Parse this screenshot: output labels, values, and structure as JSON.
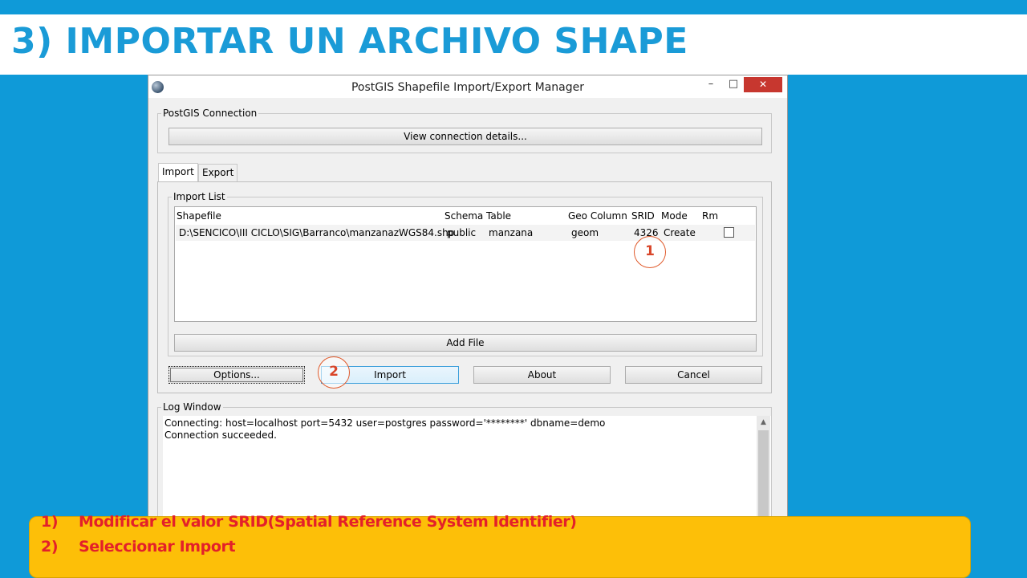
{
  "slide": {
    "title": "3) IMPORTAR UN ARCHIVO SHAPE"
  },
  "window": {
    "title": "PostGIS Shapefile Import/Export Manager",
    "minimize_glyph": "–",
    "maximize_glyph": "□",
    "close_glyph": "✕"
  },
  "connection": {
    "group_label": "PostGIS Connection",
    "view_details_label": "View connection details..."
  },
  "tabs": [
    {
      "label": "Import",
      "active": true
    },
    {
      "label": "Export",
      "active": false
    }
  ],
  "import_list": {
    "group_label": "Import List",
    "columns": [
      "Shapefile",
      "Schema",
      "Table",
      "Geo Column",
      "SRID",
      "Mode",
      "Rm"
    ],
    "rows": [
      {
        "shapefile": "D:\\SENCICO\\III CICLO\\SIG\\Barranco\\manzanazWGS84.shp",
        "schema": "public",
        "table": "manzana",
        "geo_column": "geom",
        "srid": "4326",
        "mode": "Create",
        "rm": false
      }
    ],
    "add_file_label": "Add File"
  },
  "actions": {
    "options_label": "Options...",
    "import_label": "Import",
    "about_label": "About",
    "cancel_label": "Cancel"
  },
  "log": {
    "group_label": "Log Window",
    "lines": [
      "Connecting:  host=localhost port=5432 user=postgres password='********' dbname=demo",
      "Connection succeeded."
    ]
  },
  "markers": [
    "1",
    "2"
  ],
  "notes": [
    {
      "number": "1)",
      "text": "Modificar el valor SRID(Spatial Reference System Identifier)"
    },
    {
      "number": "2)",
      "text": "Seleccionar Import"
    }
  ],
  "colors": {
    "background": "#0f9ad8",
    "title_text": "#1a9bd7",
    "note_box": "#fdbf08",
    "note_text": "#e3202a",
    "marker": "#e05a2b",
    "close_button": "#c7372f"
  }
}
